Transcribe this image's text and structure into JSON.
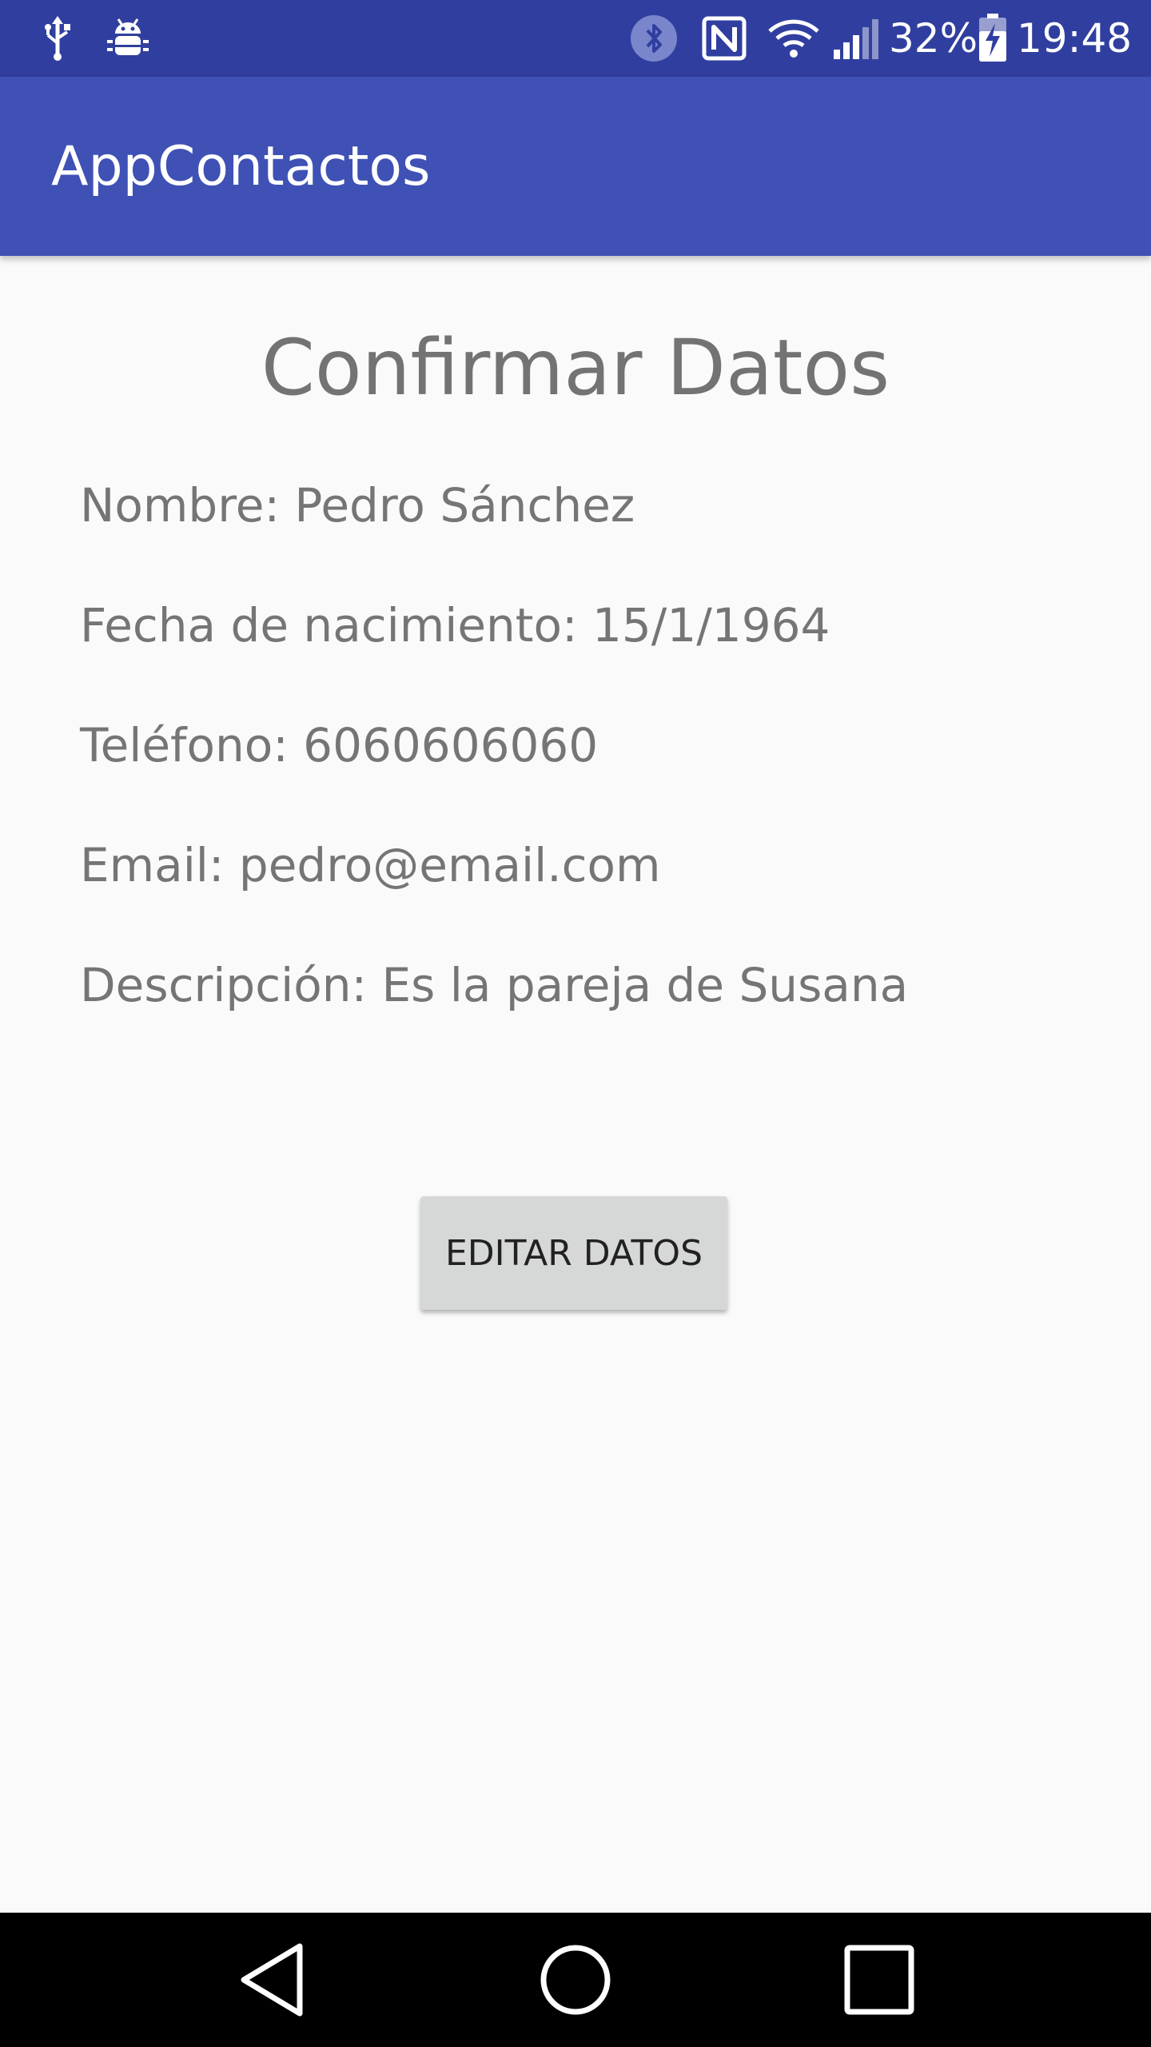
{
  "status_bar": {
    "battery_percent": "32%",
    "time": "19:48",
    "left_icons": [
      "usb-icon",
      "android-debug-icon"
    ],
    "right_icons": [
      "bluetooth-icon",
      "nfc-icon",
      "wifi-icon",
      "signal-icon",
      "battery-charging-icon"
    ]
  },
  "app_bar": {
    "title": "AppContactos"
  },
  "main": {
    "title": "Confirmar Datos",
    "fields": {
      "nombre": "Nombre: Pedro Sánchez",
      "fecha": "Fecha de nacimiento: 15/1/1964",
      "telefono": "Teléfono: 6060606060",
      "email": "Email: pedro@email.com",
      "descripcion": "Descripción: Es la pareja de Susana"
    },
    "edit_button_label": "EDITAR DATOS"
  },
  "nav_bar": {
    "buttons": [
      "back-icon",
      "home-icon",
      "recents-icon"
    ]
  },
  "colors": {
    "status_bar": "#303f9f",
    "app_bar": "#3f51b5",
    "background": "#fafafa",
    "text_secondary": "#757575",
    "button": "#d6d7d7"
  }
}
